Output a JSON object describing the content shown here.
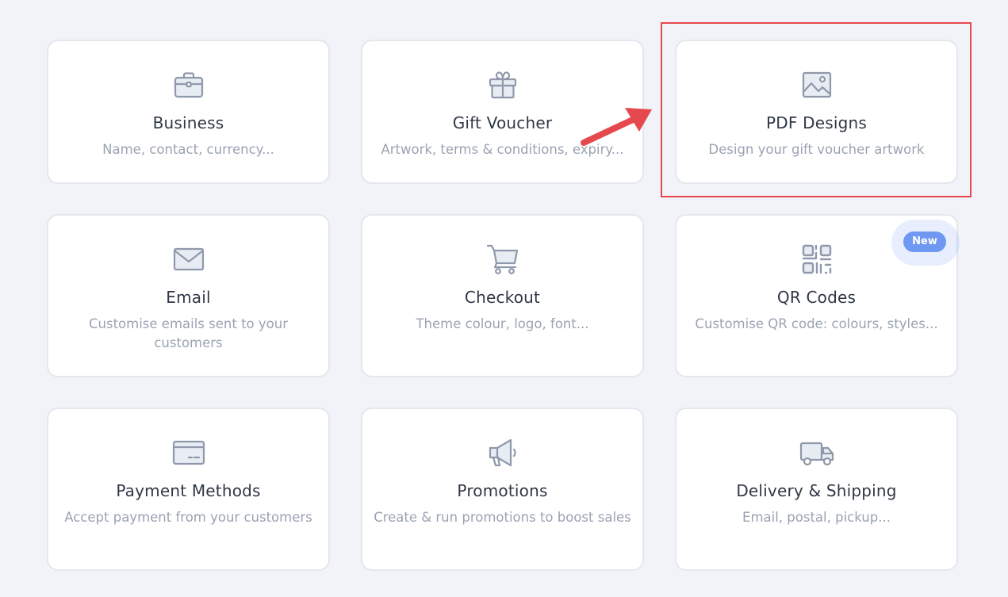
{
  "cards": [
    {
      "title": "Business",
      "desc": "Name, contact, currency...",
      "icon": "briefcase-icon"
    },
    {
      "title": "Gift Voucher",
      "desc": "Artwork, terms & conditions, expiry...",
      "icon": "gift-icon"
    },
    {
      "title": "PDF Designs",
      "desc": "Design your gift voucher artwork",
      "icon": "image-icon"
    },
    {
      "title": "Email",
      "desc": "Customise emails sent to your customers",
      "icon": "envelope-icon"
    },
    {
      "title": "Checkout",
      "desc": "Theme colour, logo, font...",
      "icon": "cart-icon"
    },
    {
      "title": "QR Codes",
      "desc": "Customise QR code: colours, styles...",
      "icon": "qr-code-icon",
      "badge": "New"
    },
    {
      "title": "Payment Methods",
      "desc": "Accept payment from your customers",
      "icon": "credit-card-icon"
    },
    {
      "title": "Promotions",
      "desc": "Create & run promotions to boost sales",
      "icon": "megaphone-icon"
    },
    {
      "title": "Delivery & Shipping",
      "desc": "Email, postal, pickup...",
      "icon": "truck-icon"
    }
  ],
  "colors": {
    "background": "#f1f3f8",
    "card": "#ffffff",
    "card_border": "#e3e7ee",
    "icon": "#8f99ab",
    "title": "#2f3747",
    "desc": "#9aa3b2",
    "highlight": "#e5484d",
    "badge": "#6e98f2"
  }
}
